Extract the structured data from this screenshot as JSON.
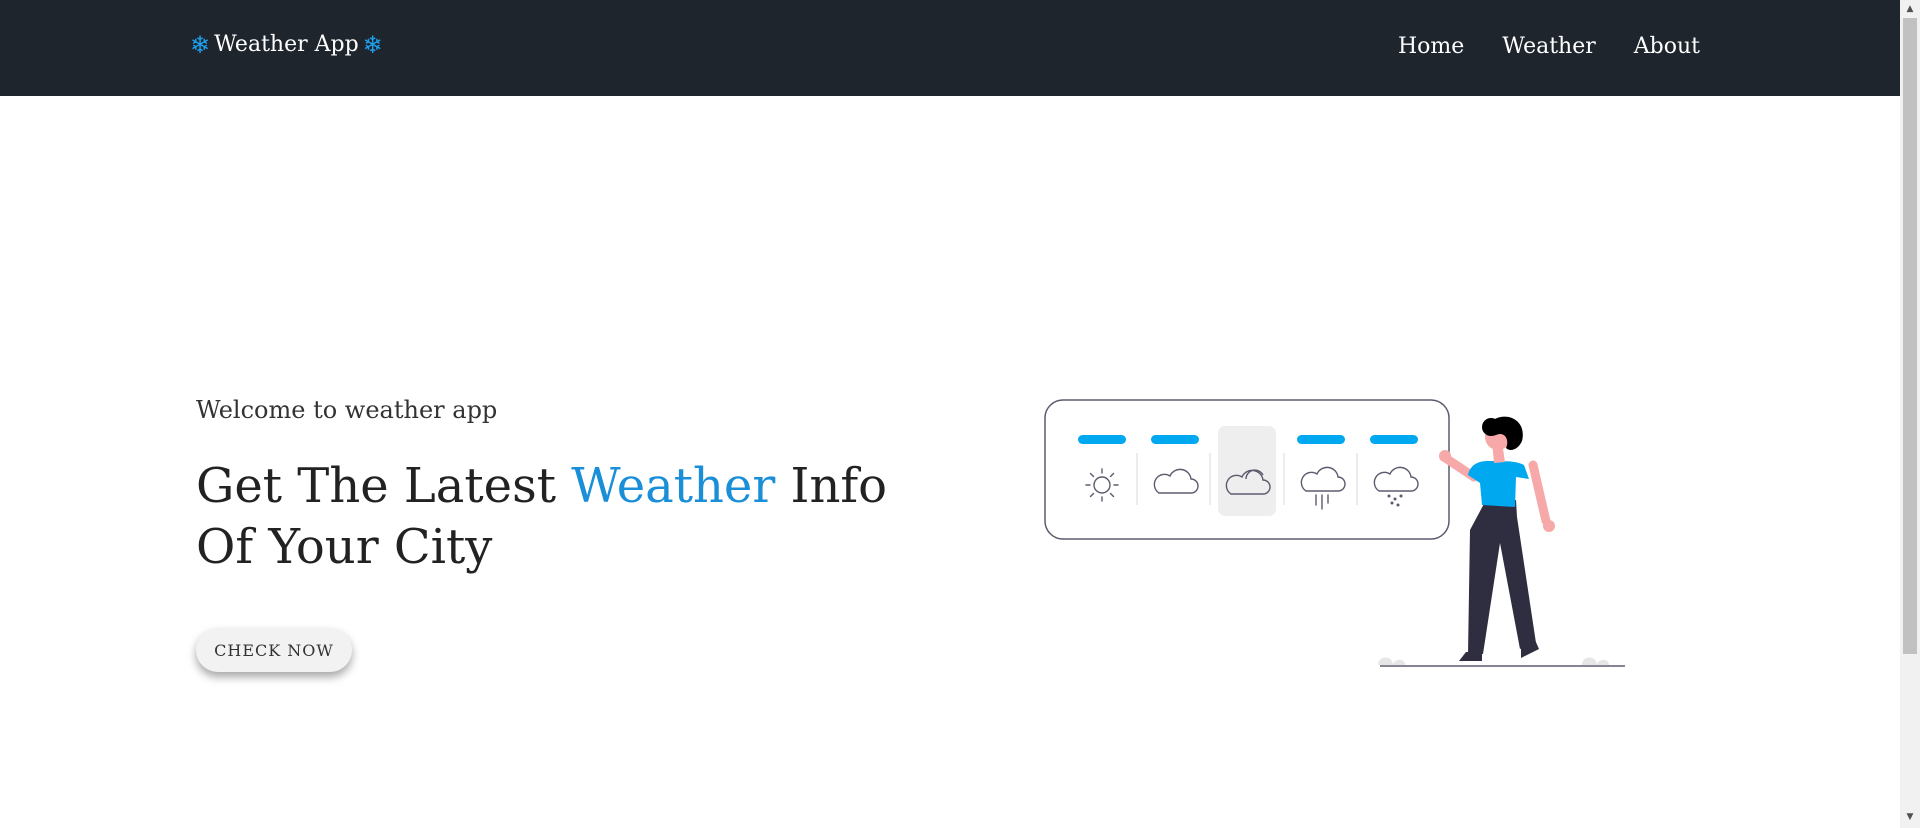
{
  "navbar": {
    "brand_left_icon": "snowflake-icon",
    "brand": "Weather App",
    "brand_right_icon": "snowflake-icon",
    "links": [
      {
        "label": "Home"
      },
      {
        "label": "Weather"
      },
      {
        "label": "About"
      }
    ]
  },
  "hero": {
    "welcome": "Welcome to weather app",
    "headline_before": "Get The Latest ",
    "headline_accent": "Weather",
    "headline_after": " Info Of Your City",
    "cta_label": "CHECK NOW"
  },
  "illustration": {
    "icons": [
      "sun-icon",
      "cloud-icon",
      "partly-cloudy-icon",
      "rain-icon",
      "snow-icon"
    ],
    "selected": "partly-cloudy-icon",
    "figure": "woman-pointing-figure"
  },
  "colors": {
    "navbar_bg": "#1f252d",
    "accent": "#1a8fd8",
    "illustration_bar": "#00a8ef",
    "button_bg": "#f2f2f2"
  }
}
